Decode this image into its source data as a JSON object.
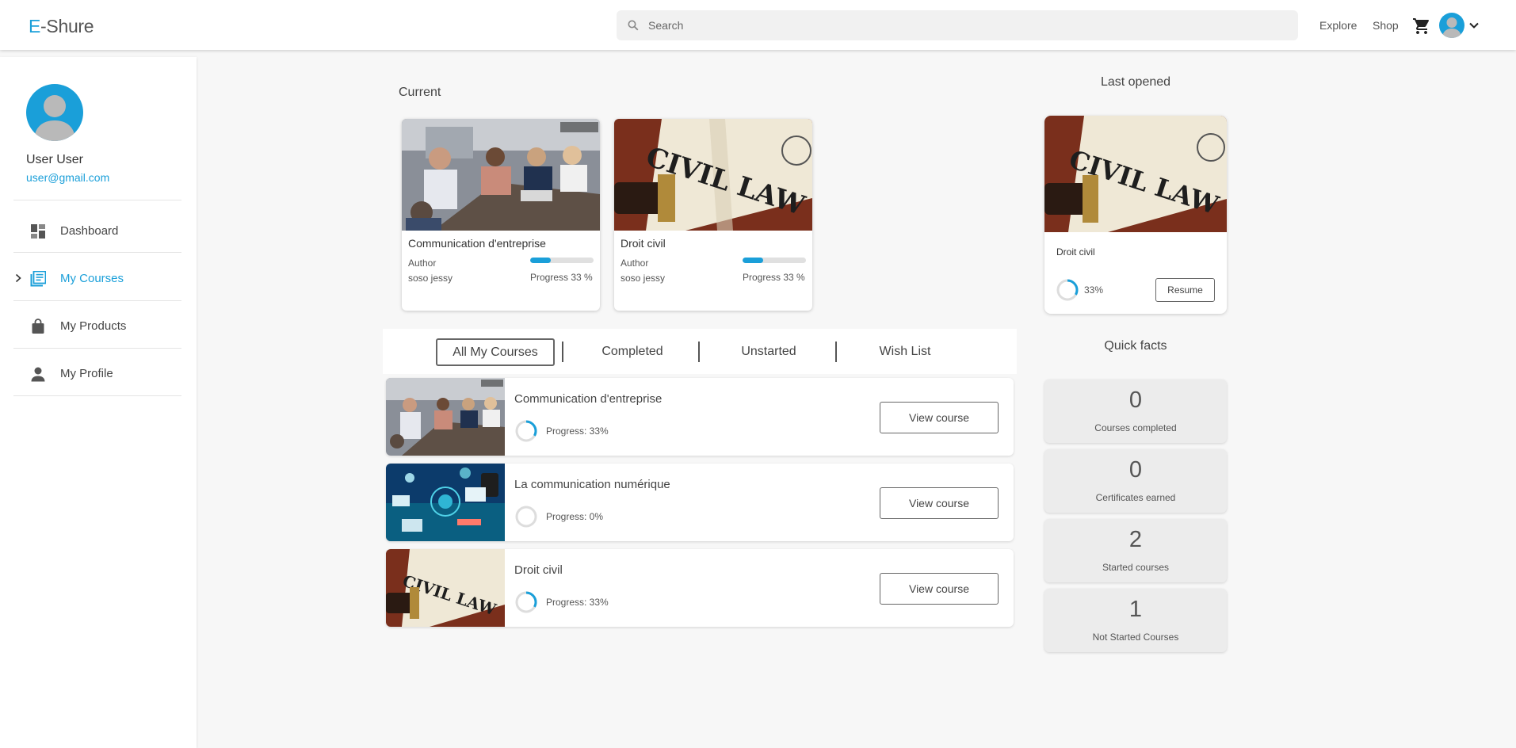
{
  "header": {
    "logo_initial": "E",
    "logo_rest": "-Shure",
    "search_placeholder": "Search",
    "nav": {
      "explore": "Explore",
      "shop": "Shop"
    }
  },
  "sidebar": {
    "user_name": "User User",
    "user_email": "user@gmail.com",
    "items": [
      {
        "label": "Dashboard",
        "icon": "dashboard-icon",
        "active": false
      },
      {
        "label": "My Courses",
        "icon": "library-books-icon",
        "active": true
      },
      {
        "label": "My Products",
        "icon": "shopping-bag-icon",
        "active": false
      },
      {
        "label": "My Profile",
        "icon": "person-icon",
        "active": false
      }
    ]
  },
  "current": {
    "title": "Current",
    "cards": [
      {
        "title": "Communication d'entreprise",
        "author_label": "Author",
        "author": "soso jessy",
        "progress_text": "Progress 33 %",
        "progress": 0.33
      },
      {
        "title": "Droit civil",
        "author_label": "Author",
        "author": "soso jessy",
        "progress_text": "Progress 33 %",
        "progress": 0.33
      }
    ]
  },
  "tabs": [
    "All My Courses",
    "Completed",
    "Unstarted",
    "Wish List"
  ],
  "courses": [
    {
      "title": "Communication d'entreprise",
      "progress_text": "Progress: 33%",
      "progress": 0.33,
      "button": "View course"
    },
    {
      "title": "La communication numérique",
      "progress_text": "Progress: 0%",
      "progress": 0,
      "button": "View course"
    },
    {
      "title": "Droit civil",
      "progress_text": "Progress: 33%",
      "progress": 0.33,
      "button": "View course"
    }
  ],
  "last_opened": {
    "heading": "Last opened",
    "title": "Droit civil",
    "percent_text": "33%",
    "progress": 0.33,
    "button": "Resume"
  },
  "quick_facts": {
    "heading": "Quick facts",
    "items": [
      {
        "value": "0",
        "label": "Courses completed"
      },
      {
        "value": "0",
        "label": "Certificates earned"
      },
      {
        "value": "2",
        "label": "Started courses"
      },
      {
        "value": "1",
        "label": "Not Started Courses"
      }
    ]
  },
  "colors": {
    "accent": "#1a9fd9",
    "ring_track": "#dddddd"
  }
}
